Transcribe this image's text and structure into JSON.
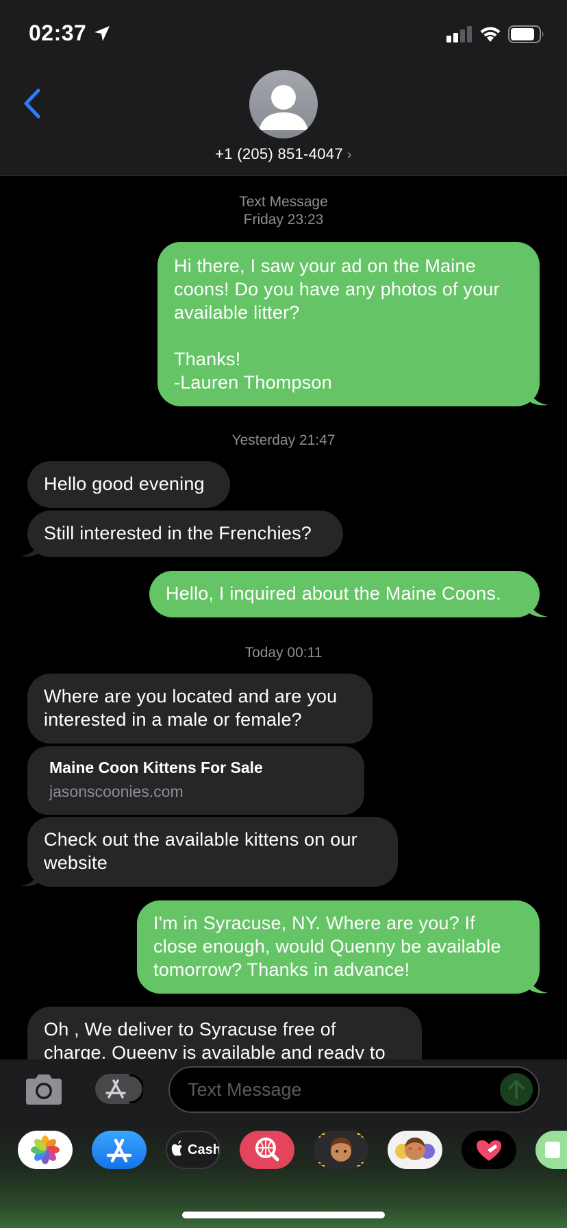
{
  "status_bar": {
    "time": "02:37"
  },
  "header": {
    "contact": "+1 (205) 851-4047"
  },
  "thread": {
    "stamp1": {
      "label": "Text Message",
      "time": "Friday 23:23"
    },
    "msg1": [
      "Hi there, I saw your ad on the Maine",
      "coons! Do you have any photos of your",
      "available litter?",
      "",
      "Thanks!",
      "-Lauren Thompson"
    ],
    "stamp2": "Yesterday 21:47",
    "msg2": "Hello good evening",
    "msg3": "Still interested in the Frenchies?",
    "msg4": "Hello, I inquired about the Maine Coons.",
    "stamp3": "Today 00:11",
    "msg5": [
      "Where are you located and are you",
      "interested in a male or female?"
    ],
    "link": {
      "title": "Maine Coon Kittens For Sale",
      "domain": "jasonscoonies.com"
    },
    "msg6": [
      "Check out the available kittens on our",
      "website"
    ],
    "msg7": [
      "I'm in Syracuse, NY. Where are you? If",
      "close enough, would Quenny be available",
      "tomorrow? Thanks in advance!"
    ],
    "msg8": [
      "Oh , We deliver to Syracuse free of",
      "charge. Queeny is available and ready to"
    ]
  },
  "input": {
    "placeholder": "Text Message"
  },
  "app_drawer": {
    "cash_label": "Cash",
    "apps": [
      "photos-icon",
      "app-store-icon",
      "apple-cash-icon",
      "web-search-icon",
      "memoji-icon",
      "animoji-icon",
      "digital-touch-icon",
      "more-apps-icon"
    ]
  },
  "colors": {
    "outgoing": "#65c466",
    "incoming": "#262628",
    "accent": "#2f7cf6"
  }
}
